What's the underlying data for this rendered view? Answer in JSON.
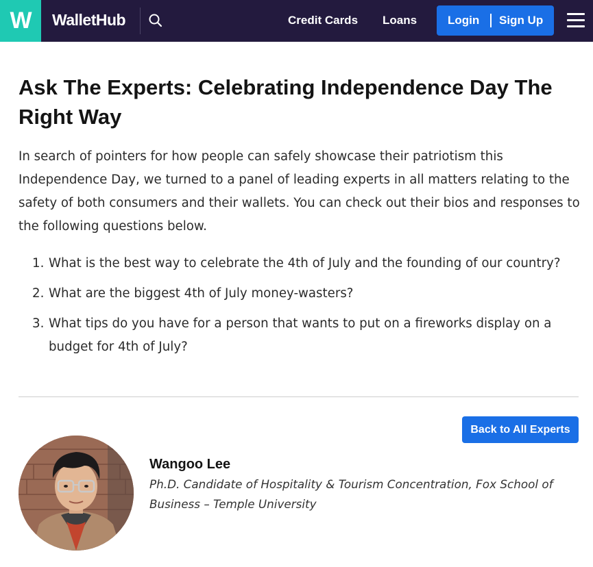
{
  "header": {
    "logo_letter": "W",
    "brand": "WalletHub",
    "nav": [
      "Credit Cards",
      "Loans"
    ],
    "login_label": "Login",
    "signup_label": "Sign Up"
  },
  "article": {
    "title": "Ask The Experts: Celebrating Independence Day The Right Way",
    "intro": "In search of pointers for how people can safely showcase their patriotism this Independence Day, we turned to a panel of leading experts in all matters relating to the safety of both consumers and their wallets. You can check out their bios and responses to the following questions below.",
    "questions": [
      {
        "num": "1.",
        "text": "What is the best way to celebrate the 4th of July and the founding of our country?"
      },
      {
        "num": "2.",
        "text": "What are the biggest 4th of July money-wasters?"
      },
      {
        "num": "3.",
        "text": "What tips do you have for a person that wants to put on a fireworks display on a budget for 4th of July?"
      }
    ]
  },
  "expert": {
    "back_label": "Back to All Experts",
    "name": "Wangoo Lee",
    "title": "Ph.D. Candidate of Hospitality & Tourism Concentration, Fox School of Business – Temple University"
  },
  "colors": {
    "header_bg": "#231a3e",
    "logo_teal": "#1fc9b3",
    "button_blue": "#1a6fe6"
  }
}
